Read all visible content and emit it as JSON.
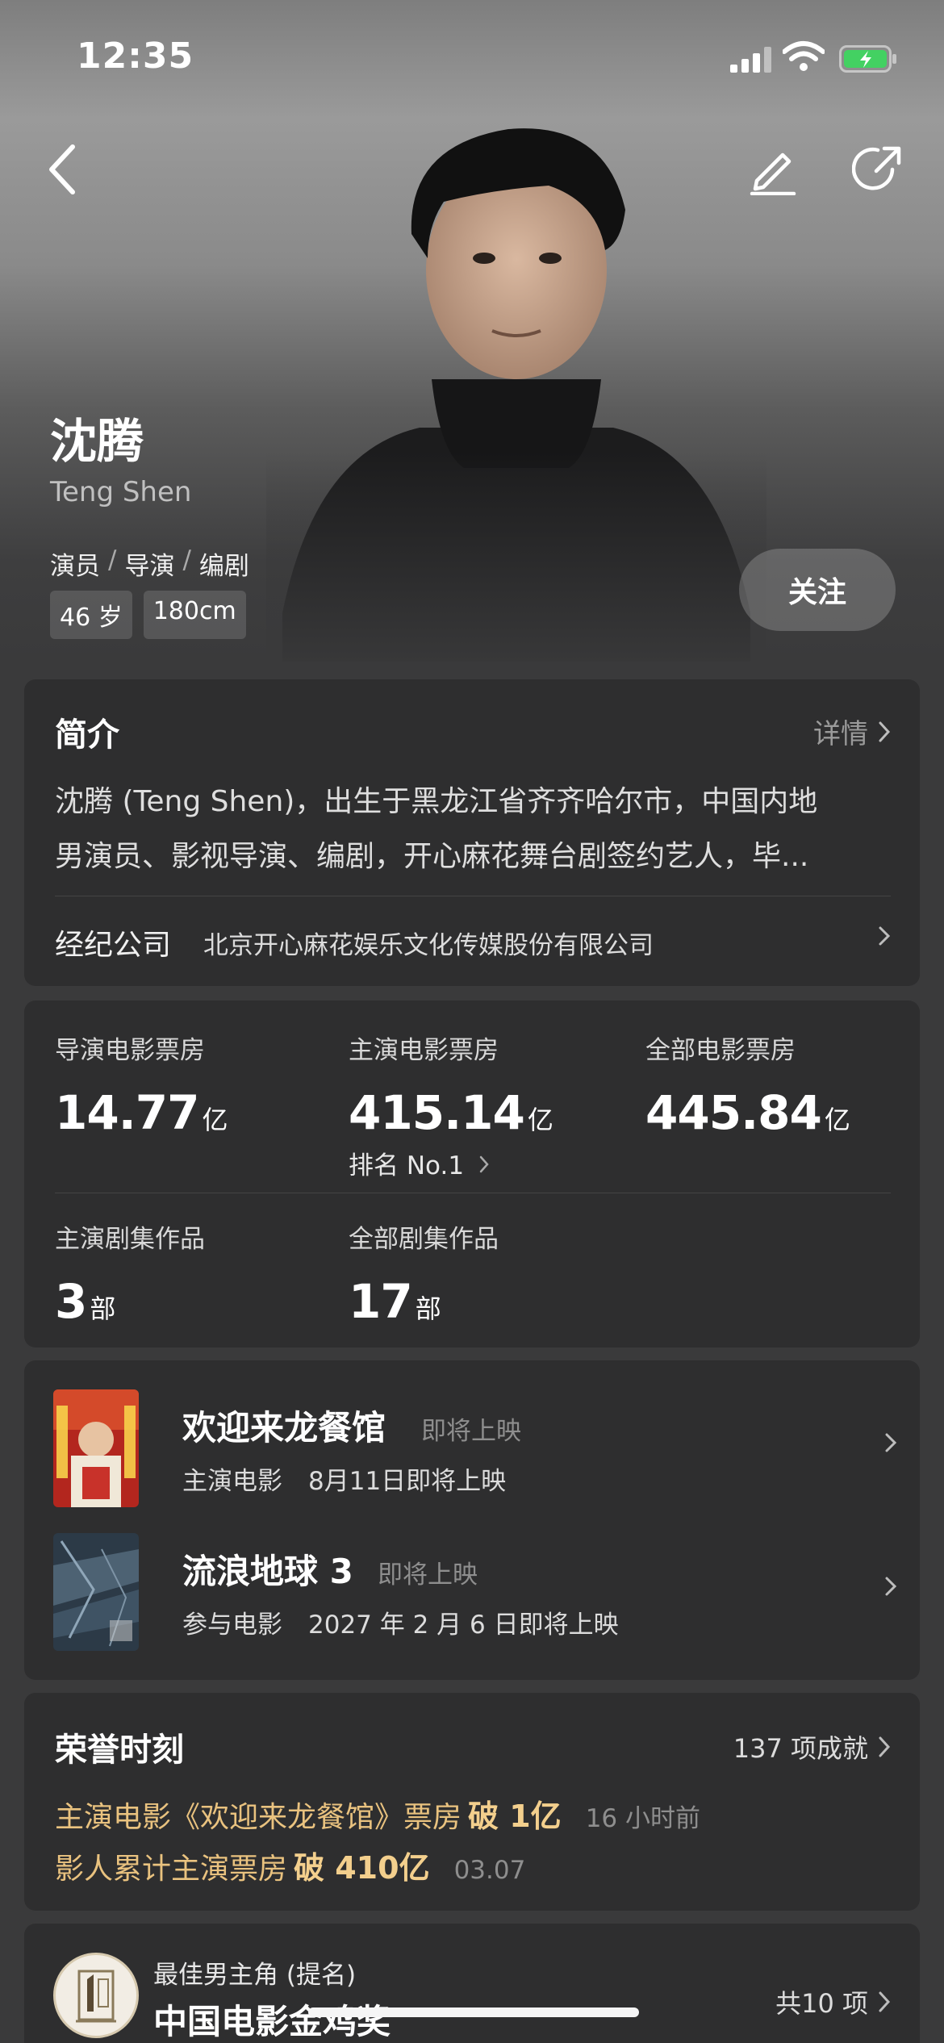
{
  "status_bar": {
    "time": "12:35"
  },
  "hero": {
    "name": "沈腾",
    "name_en": "Teng Shen",
    "roles": [
      "演员",
      "导演",
      "编剧"
    ],
    "separator": "/",
    "tags": [
      "46 岁",
      "180cm"
    ],
    "follow_label": "关注"
  },
  "intro": {
    "title": "简介",
    "more_label": "详情",
    "description_line1": "沈腾 (Teng Shen)，出生于黑龙江省齐齐哈尔市，中国内地",
    "description_line2": "男演员、影视导演、编剧，开心麻花舞台剧签约艺人，毕...",
    "agency_label": "经纪公司",
    "agency_name": "北京开心麻花娱乐文化传媒股份有限公司"
  },
  "stats": {
    "director_box_office": {
      "label": "导演电影票房",
      "value": "14.77",
      "unit": "亿"
    },
    "lead_box_office": {
      "label": "主演电影票房",
      "value": "415.14",
      "unit": "亿",
      "rank": "排名 No.1"
    },
    "total_box_office": {
      "label": "全部电影票房",
      "value": "445.84",
      "unit": "亿"
    },
    "lead_series": {
      "label": "主演剧集作品",
      "value": "3",
      "unit": "部"
    },
    "all_series": {
      "label": "全部剧集作品",
      "value": "17",
      "unit": "部"
    }
  },
  "films": [
    {
      "title": "欢迎来龙餐馆",
      "status": "即将上映",
      "role": "主演电影",
      "release": "8月11日即将上映"
    },
    {
      "title": "流浪地球 3",
      "status": "即将上映",
      "role": "参与电影",
      "release": "2027 年 2 月 6 日即将上映"
    }
  ],
  "honors": {
    "title": "荣誉时刻",
    "count_label": "137 项成就",
    "items": [
      {
        "text": "主演电影《欢迎来龙餐馆》票房",
        "highlight": "破 1亿",
        "time": "16 小时前"
      },
      {
        "text": "影人累计主演票房",
        "highlight": "破 410亿",
        "time": "03.07"
      }
    ]
  },
  "award": {
    "prize": "最佳男主角 (提名)",
    "org": "中国电影金鸡奖",
    "total_label": "共10 项"
  },
  "colors": {
    "accent_gold": "#e9c27f",
    "card_bg": "#2e2e2f",
    "page_bg": "#3a3a3b"
  }
}
